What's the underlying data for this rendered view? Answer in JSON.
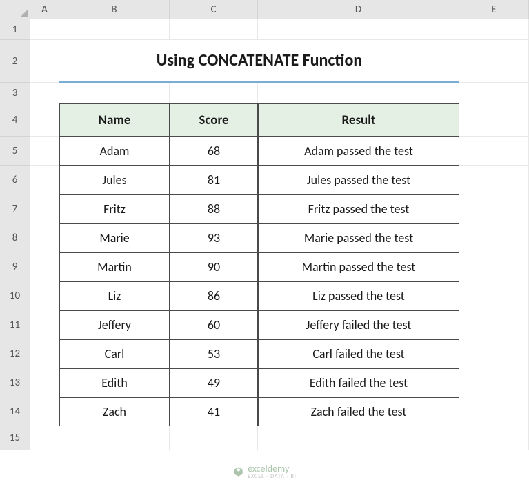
{
  "columns": [
    "A",
    "B",
    "C",
    "D",
    "E"
  ],
  "rows": [
    "1",
    "2",
    "3",
    "4",
    "5",
    "6",
    "7",
    "8",
    "9",
    "10",
    "11",
    "12",
    "13",
    "14",
    "15"
  ],
  "title": "Using CONCATENATE Function",
  "headers": {
    "name": "Name",
    "score": "Score",
    "result": "Result"
  },
  "data": [
    {
      "name": "Adam",
      "score": "68",
      "result": "Adam passed the test"
    },
    {
      "name": "Jules",
      "score": "81",
      "result": "Jules passed the test"
    },
    {
      "name": "Fritz",
      "score": "88",
      "result": "Fritz passed the test"
    },
    {
      "name": "Marie",
      "score": "93",
      "result": "Marie passed the test"
    },
    {
      "name": "Martin",
      "score": "90",
      "result": "Martin passed the test"
    },
    {
      "name": "Liz",
      "score": "86",
      "result": "Liz passed the test"
    },
    {
      "name": "Jeffery",
      "score": "60",
      "result": "Jeffery failed the test"
    },
    {
      "name": "Carl",
      "score": "53",
      "result": "Carl failed the test"
    },
    {
      "name": "Edith",
      "score": "49",
      "result": "Edith failed the test"
    },
    {
      "name": "Zach",
      "score": "41",
      "result": "Zach failed the test"
    }
  ],
  "watermark": {
    "brand": "exceldemy",
    "tagline": "EXCEL · DATA · BI"
  }
}
